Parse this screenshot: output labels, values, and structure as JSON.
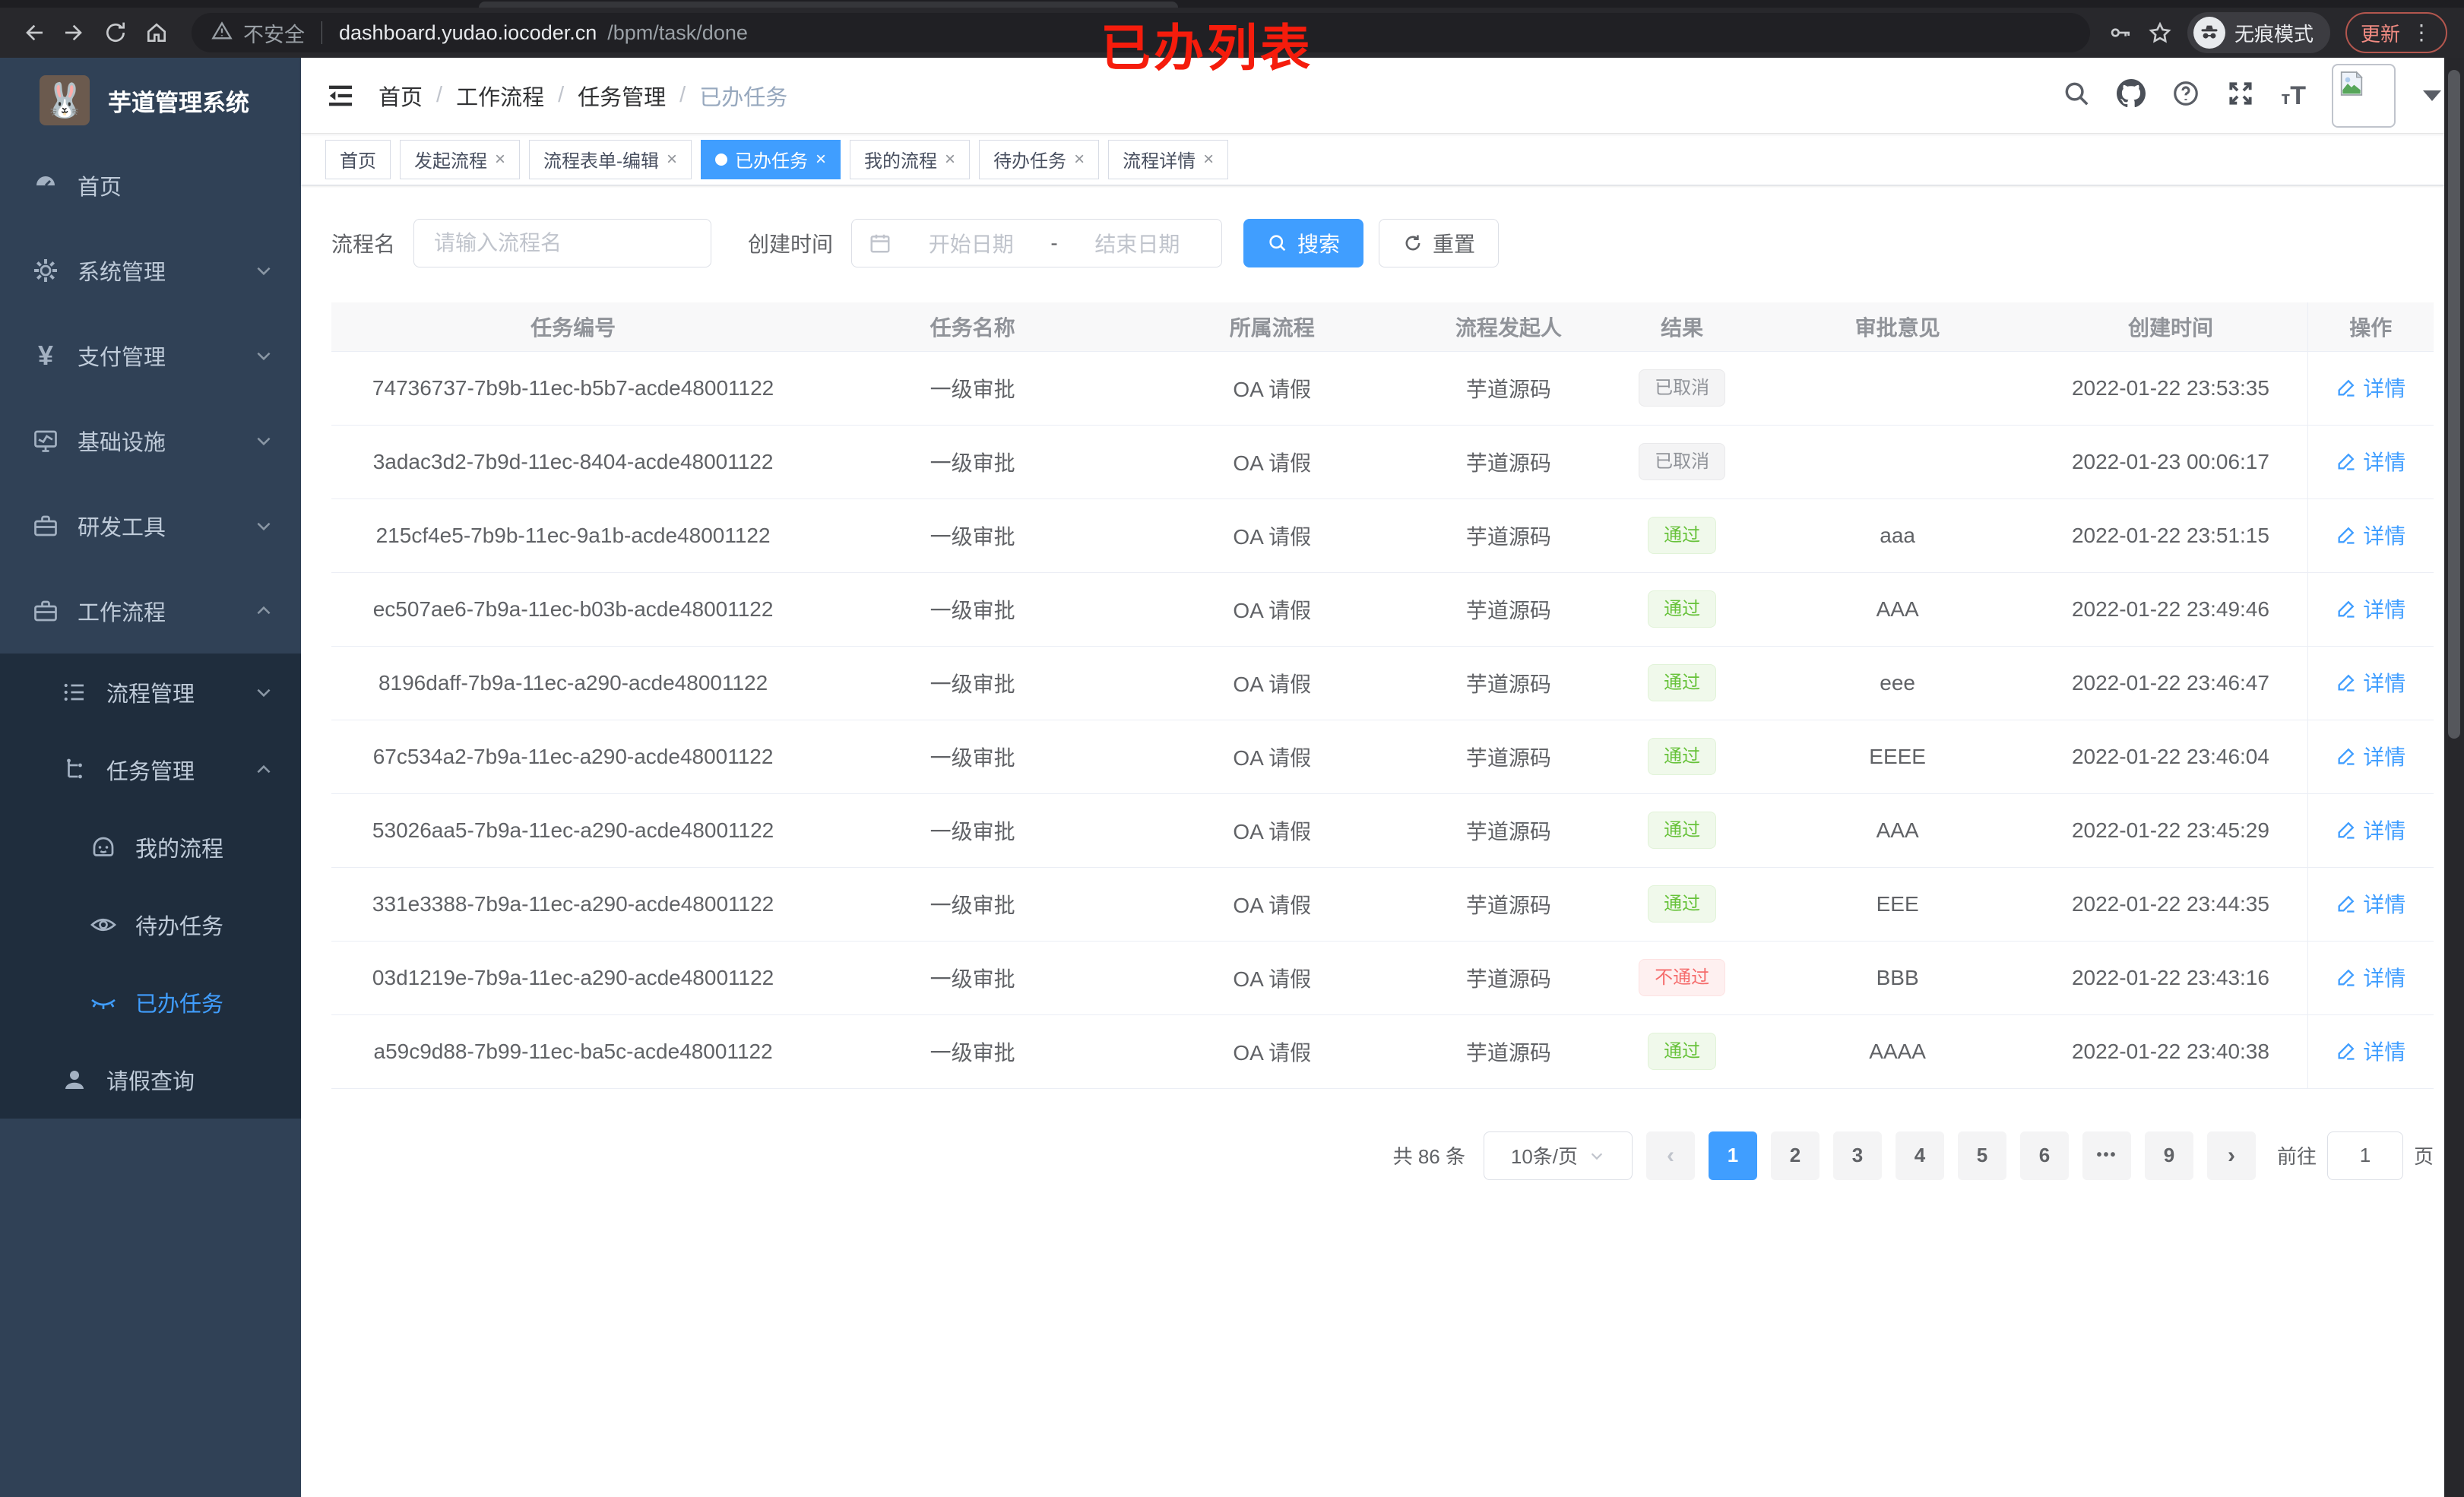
{
  "colors": {
    "accent": "#409eff",
    "success": "#67c23a",
    "danger": "#f56c6c",
    "info": "#909399",
    "sidebar_bg": "#304156",
    "submenu_bg": "#1f2d3d"
  },
  "browser": {
    "security_label": "不安全",
    "url_host": "dashboard.yudao.iocoder.cn",
    "url_path": "/bpm/task/done",
    "incognito_label": "无痕模式",
    "update_label": "更新",
    "kebab_glyph": "⋮"
  },
  "annotation": {
    "text": "已办列表"
  },
  "sidebar": {
    "title": "芋道管理系统",
    "menu": [
      {
        "label": "首页"
      },
      {
        "label": "系统管理"
      },
      {
        "label": "支付管理"
      },
      {
        "label": "基础设施"
      },
      {
        "label": "研发工具"
      },
      {
        "label": "工作流程"
      }
    ],
    "submenu": [
      {
        "label": "流程管理"
      },
      {
        "label": "任务管理"
      },
      {
        "label": "我的流程"
      },
      {
        "label": "待办任务"
      },
      {
        "label": "已办任务"
      },
      {
        "label": "请假查询"
      }
    ],
    "yen_glyph": "¥"
  },
  "header": {
    "breadcrumb": [
      "首页",
      "工作流程",
      "任务管理",
      "已办任务"
    ],
    "separator": "/"
  },
  "tabs": {
    "close_glyph": "×",
    "items": [
      {
        "label": "首页"
      },
      {
        "label": "发起流程"
      },
      {
        "label": "流程表单-编辑"
      },
      {
        "label": "已办任务"
      },
      {
        "label": "我的流程"
      },
      {
        "label": "待办任务"
      },
      {
        "label": "流程详情"
      }
    ]
  },
  "filters": {
    "name_label": "流程名",
    "name_placeholder": "请输入流程名",
    "time_label": "创建时间",
    "start_placeholder": "开始日期",
    "range_separator": "-",
    "end_placeholder": "结束日期",
    "search_label": "搜索",
    "reset_label": "重置"
  },
  "table": {
    "columns": [
      "任务编号",
      "任务名称",
      "所属流程",
      "流程发起人",
      "结果",
      "审批意见",
      "创建时间",
      "操作"
    ],
    "detail_label": "详情",
    "rows": [
      {
        "id": "74736737-7b9b-11ec-b5b7-acde48001122",
        "name": "一级审批",
        "process": "OA 请假",
        "starter": "芋道源码",
        "result": "已取消",
        "comment": "",
        "time": "2022-01-22 23:53:35"
      },
      {
        "id": "3adac3d2-7b9d-11ec-8404-acde48001122",
        "name": "一级审批",
        "process": "OA 请假",
        "starter": "芋道源码",
        "result": "已取消",
        "comment": "",
        "time": "2022-01-23 00:06:17"
      },
      {
        "id": "215cf4e5-7b9b-11ec-9a1b-acde48001122",
        "name": "一级审批",
        "process": "OA 请假",
        "starter": "芋道源码",
        "result": "通过",
        "comment": "aaa",
        "time": "2022-01-22 23:51:15"
      },
      {
        "id": "ec507ae6-7b9a-11ec-b03b-acde48001122",
        "name": "一级审批",
        "process": "OA 请假",
        "starter": "芋道源码",
        "result": "通过",
        "comment": "AAA",
        "time": "2022-01-22 23:49:46"
      },
      {
        "id": "8196daff-7b9a-11ec-a290-acde48001122",
        "name": "一级审批",
        "process": "OA 请假",
        "starter": "芋道源码",
        "result": "通过",
        "comment": "eee",
        "time": "2022-01-22 23:46:47"
      },
      {
        "id": "67c534a2-7b9a-11ec-a290-acde48001122",
        "name": "一级审批",
        "process": "OA 请假",
        "starter": "芋道源码",
        "result": "通过",
        "comment": "EEEE",
        "time": "2022-01-22 23:46:04"
      },
      {
        "id": "53026aa5-7b9a-11ec-a290-acde48001122",
        "name": "一级审批",
        "process": "OA 请假",
        "starter": "芋道源码",
        "result": "通过",
        "comment": "AAA",
        "time": "2022-01-22 23:45:29"
      },
      {
        "id": "331e3388-7b9a-11ec-a290-acde48001122",
        "name": "一级审批",
        "process": "OA 请假",
        "starter": "芋道源码",
        "result": "通过",
        "comment": "EEE",
        "time": "2022-01-22 23:44:35"
      },
      {
        "id": "03d1219e-7b9a-11ec-a290-acde48001122",
        "name": "一级审批",
        "process": "OA 请假",
        "starter": "芋道源码",
        "result": "不通过",
        "comment": "BBB",
        "time": "2022-01-22 23:43:16"
      },
      {
        "id": "a59c9d88-7b99-11ec-ba5c-acde48001122",
        "name": "一级审批",
        "process": "OA 请假",
        "starter": "芋道源码",
        "result": "通过",
        "comment": "AAAA",
        "time": "2022-01-22 23:40:38"
      }
    ]
  },
  "pagination": {
    "total_label": "共 86 条",
    "page_size_label": "10条/页",
    "prev_glyph": "‹",
    "next_glyph": "›",
    "pages": [
      "1",
      "2",
      "3",
      "4",
      "5",
      "6",
      "•••",
      "9"
    ],
    "goto_label": "前往",
    "goto_value": "1",
    "page_unit_label": "页"
  }
}
